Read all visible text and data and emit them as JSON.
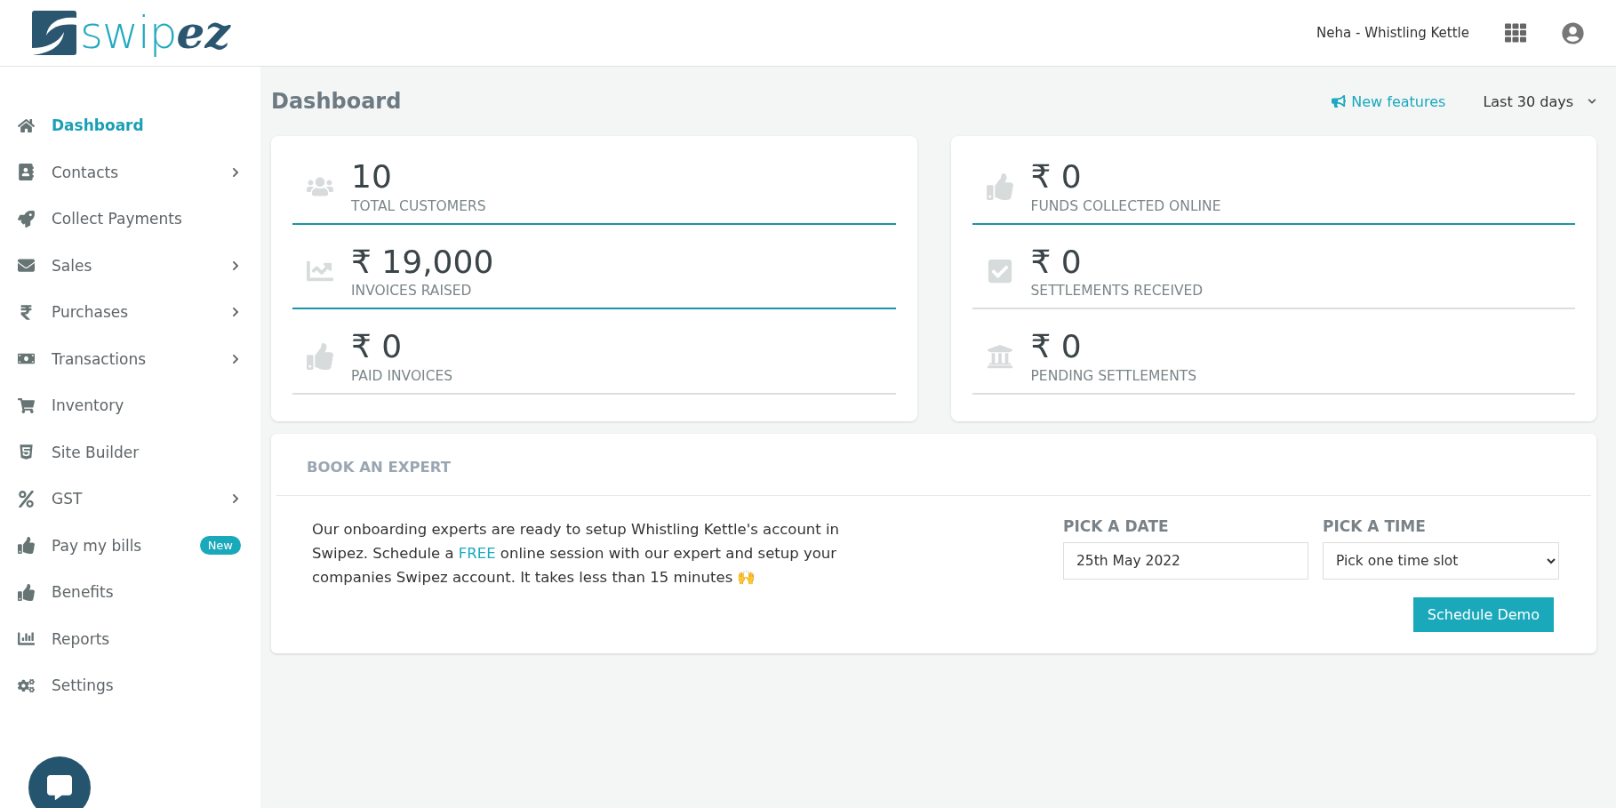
{
  "header": {
    "logo": {
      "light": "swip",
      "bold": "ez"
    },
    "user": "Neha - Whistling Kettle"
  },
  "sidebar": {
    "items": [
      {
        "label": "Dashboard",
        "selected": true,
        "submenu": false
      },
      {
        "label": "Contacts",
        "selected": false,
        "submenu": true
      },
      {
        "label": "Collect Payments",
        "selected": false,
        "submenu": false
      },
      {
        "label": "Sales",
        "selected": false,
        "submenu": true
      },
      {
        "label": "Purchases",
        "selected": false,
        "submenu": true
      },
      {
        "label": "Transactions",
        "selected": false,
        "submenu": true
      },
      {
        "label": "Inventory",
        "selected": false,
        "submenu": false
      },
      {
        "label": "Site Builder",
        "selected": false,
        "submenu": false
      },
      {
        "label": "GST",
        "selected": false,
        "submenu": true
      },
      {
        "label": "Pay my bills",
        "selected": false,
        "submenu": false,
        "badge": "New"
      },
      {
        "label": "Benefits",
        "selected": false,
        "submenu": false
      },
      {
        "label": "Reports",
        "selected": false,
        "submenu": false
      },
      {
        "label": "Settings",
        "selected": false,
        "submenu": false
      }
    ]
  },
  "page": {
    "title": "Dashboard",
    "new_features": "New features",
    "range": "Last 30 days"
  },
  "stat_cards": [
    {
      "stats": [
        {
          "value": "10",
          "label": "TOTAL CUSTOMERS",
          "accent": true
        },
        {
          "value": "₹ 19,000",
          "label": "INVOICES RAISED",
          "accent": true
        },
        {
          "value": "₹ 0",
          "label": "PAID INVOICES",
          "accent": false
        }
      ]
    },
    {
      "stats": [
        {
          "value": "₹ 0",
          "label": "FUNDS COLLECTED ONLINE",
          "accent": true
        },
        {
          "value": "₹ 0",
          "label": "SETTLEMENTS RECEIVED",
          "accent": false
        },
        {
          "value": "₹ 0",
          "label": "PENDING SETTLEMENTS",
          "accent": false
        }
      ]
    }
  ],
  "book_expert": {
    "title": "BOOK AN EXPERT",
    "text_before": "Our onboarding experts are ready to setup Whistling Kettle's account in Swipez. Schedule a ",
    "link": "FREE",
    "text_after": " online session with our expert and setup your companies Swipez account. It takes less than 15 minutes 🙌",
    "date_label": "PICK A DATE",
    "date_value": "25th May 2022",
    "time_label": "PICK A TIME",
    "time_value": "Pick one time slot",
    "button": "Schedule Demo"
  }
}
